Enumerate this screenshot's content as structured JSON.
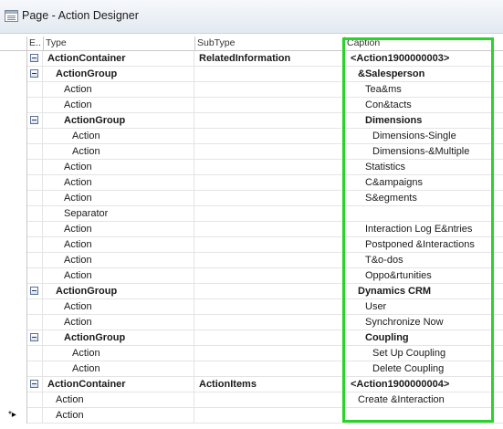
{
  "window": {
    "title": "Page - Action Designer"
  },
  "columns": {
    "expand": "E..",
    "type": "Type",
    "subtype": "SubType",
    "caption": "Caption"
  },
  "rows": [
    {
      "expander": true,
      "indent": 0,
      "bold": true,
      "type": "ActionContainer",
      "subtype": "RelatedInformation",
      "caption": "<Action1900000003>",
      "cindent": 0
    },
    {
      "expander": true,
      "indent": 1,
      "bold": true,
      "type": "ActionGroup",
      "subtype": "",
      "caption": "&Salesperson",
      "cindent": 1
    },
    {
      "expander": false,
      "indent": 2,
      "bold": false,
      "type": "Action",
      "subtype": "",
      "caption": "Tea&ms",
      "cindent": 2
    },
    {
      "expander": false,
      "indent": 2,
      "bold": false,
      "type": "Action",
      "subtype": "",
      "caption": "Con&tacts",
      "cindent": 2
    },
    {
      "expander": true,
      "indent": 2,
      "bold": true,
      "type": "ActionGroup",
      "subtype": "",
      "caption": "Dimensions",
      "cindent": 2
    },
    {
      "expander": false,
      "indent": 3,
      "bold": false,
      "type": "Action",
      "subtype": "",
      "caption": "Dimensions-Single",
      "cindent": 3
    },
    {
      "expander": false,
      "indent": 3,
      "bold": false,
      "type": "Action",
      "subtype": "",
      "caption": "Dimensions-&Multiple",
      "cindent": 3
    },
    {
      "expander": false,
      "indent": 2,
      "bold": false,
      "type": "Action",
      "subtype": "",
      "caption": "Statistics",
      "cindent": 2
    },
    {
      "expander": false,
      "indent": 2,
      "bold": false,
      "type": "Action",
      "subtype": "",
      "caption": "C&ampaigns",
      "cindent": 2
    },
    {
      "expander": false,
      "indent": 2,
      "bold": false,
      "type": "Action",
      "subtype": "",
      "caption": "S&egments",
      "cindent": 2
    },
    {
      "expander": false,
      "indent": 2,
      "bold": false,
      "type": "Separator",
      "subtype": "",
      "caption": "",
      "cindent": 2
    },
    {
      "expander": false,
      "indent": 2,
      "bold": false,
      "type": "Action",
      "subtype": "",
      "caption": "Interaction Log E&ntries",
      "cindent": 2
    },
    {
      "expander": false,
      "indent": 2,
      "bold": false,
      "type": "Action",
      "subtype": "",
      "caption": "Postponed &Interactions",
      "cindent": 2
    },
    {
      "expander": false,
      "indent": 2,
      "bold": false,
      "type": "Action",
      "subtype": "",
      "caption": "T&o-dos",
      "cindent": 2
    },
    {
      "expander": false,
      "indent": 2,
      "bold": false,
      "type": "Action",
      "subtype": "",
      "caption": "Oppo&rtunities",
      "cindent": 2
    },
    {
      "expander": true,
      "indent": 1,
      "bold": true,
      "type": "ActionGroup",
      "subtype": "",
      "caption": "Dynamics CRM",
      "cindent": 1
    },
    {
      "expander": false,
      "indent": 2,
      "bold": false,
      "type": "Action",
      "subtype": "",
      "caption": "User",
      "cindent": 2
    },
    {
      "expander": false,
      "indent": 2,
      "bold": false,
      "type": "Action",
      "subtype": "",
      "caption": "Synchronize Now",
      "cindent": 2
    },
    {
      "expander": true,
      "indent": 2,
      "bold": true,
      "type": "ActionGroup",
      "subtype": "",
      "caption": "Coupling",
      "cindent": 2
    },
    {
      "expander": false,
      "indent": 3,
      "bold": false,
      "type": "Action",
      "subtype": "",
      "caption": "Set Up Coupling",
      "cindent": 3
    },
    {
      "expander": false,
      "indent": 3,
      "bold": false,
      "type": "Action",
      "subtype": "",
      "caption": "Delete Coupling",
      "cindent": 3
    },
    {
      "expander": true,
      "indent": 0,
      "bold": true,
      "type": "ActionContainer",
      "subtype": "ActionItems",
      "caption": "<Action1900000004>",
      "cindent": 0
    },
    {
      "expander": false,
      "indent": 1,
      "bold": false,
      "type": "Action",
      "subtype": "",
      "caption": "Create &Interaction",
      "cindent": 1
    },
    {
      "expander": false,
      "indent": 1,
      "bold": false,
      "type": "Action",
      "subtype": "",
      "caption": "",
      "cindent": 1,
      "newrow": true
    }
  ],
  "new_row_marker": "*▸",
  "highlight_color": "#28d428"
}
